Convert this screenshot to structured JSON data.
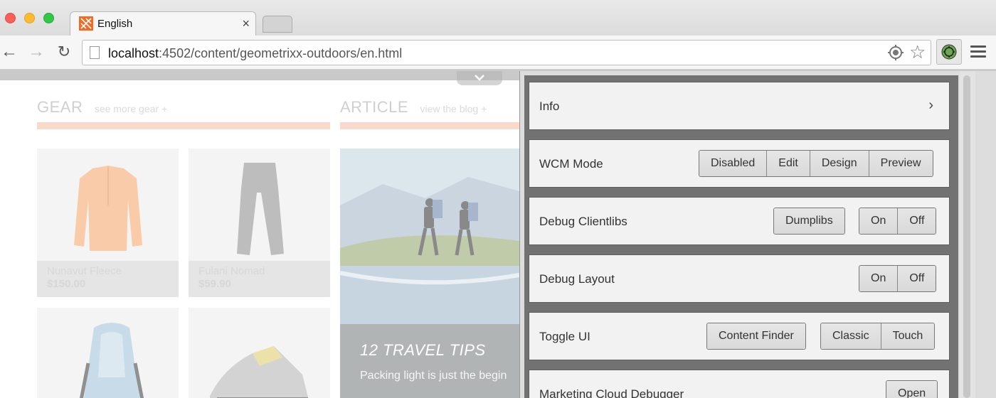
{
  "browser": {
    "tab_title": "English",
    "tab_close": "×",
    "url_host": "localhost",
    "url_path": ":4502/content/geometrixx-outdoors/en.html",
    "nav_back": "←",
    "nav_forward": "→",
    "nav_reload": "↻",
    "star": "☆"
  },
  "page": {
    "gear_title": "GEAR",
    "gear_link": "see more gear +",
    "article_title": "ARTICLE",
    "article_link": "view the blog +",
    "products": [
      {
        "name": "Nunavut Fleece",
        "price": "$150.00"
      },
      {
        "name": "Fulani Nomad",
        "price": "$59.90"
      }
    ],
    "article": {
      "heading": "12 TRAVEL TIPS",
      "text": "Packing light is just the begin"
    }
  },
  "popup": {
    "info": {
      "label": "Info",
      "chevron": "›"
    },
    "wcm_mode": {
      "label": "WCM Mode",
      "buttons": [
        "Disabled",
        "Edit",
        "Design",
        "Preview"
      ]
    },
    "debug_clientlibs": {
      "label": "Debug Clientlibs",
      "dumplibs": "Dumplibs",
      "on": "On",
      "off": "Off"
    },
    "debug_layout": {
      "label": "Debug Layout",
      "on": "On",
      "off": "Off"
    },
    "toggle_ui": {
      "label": "Toggle UI",
      "content_finder": "Content Finder",
      "classic": "Classic",
      "touch": "Touch"
    },
    "marketing_cloud": {
      "label": "Marketing Cloud Debugger",
      "open": "Open"
    }
  },
  "colors": {
    "accent_rule": "#f5c5b0",
    "favicon": "#f26b21",
    "popup_frame": "#727272"
  }
}
